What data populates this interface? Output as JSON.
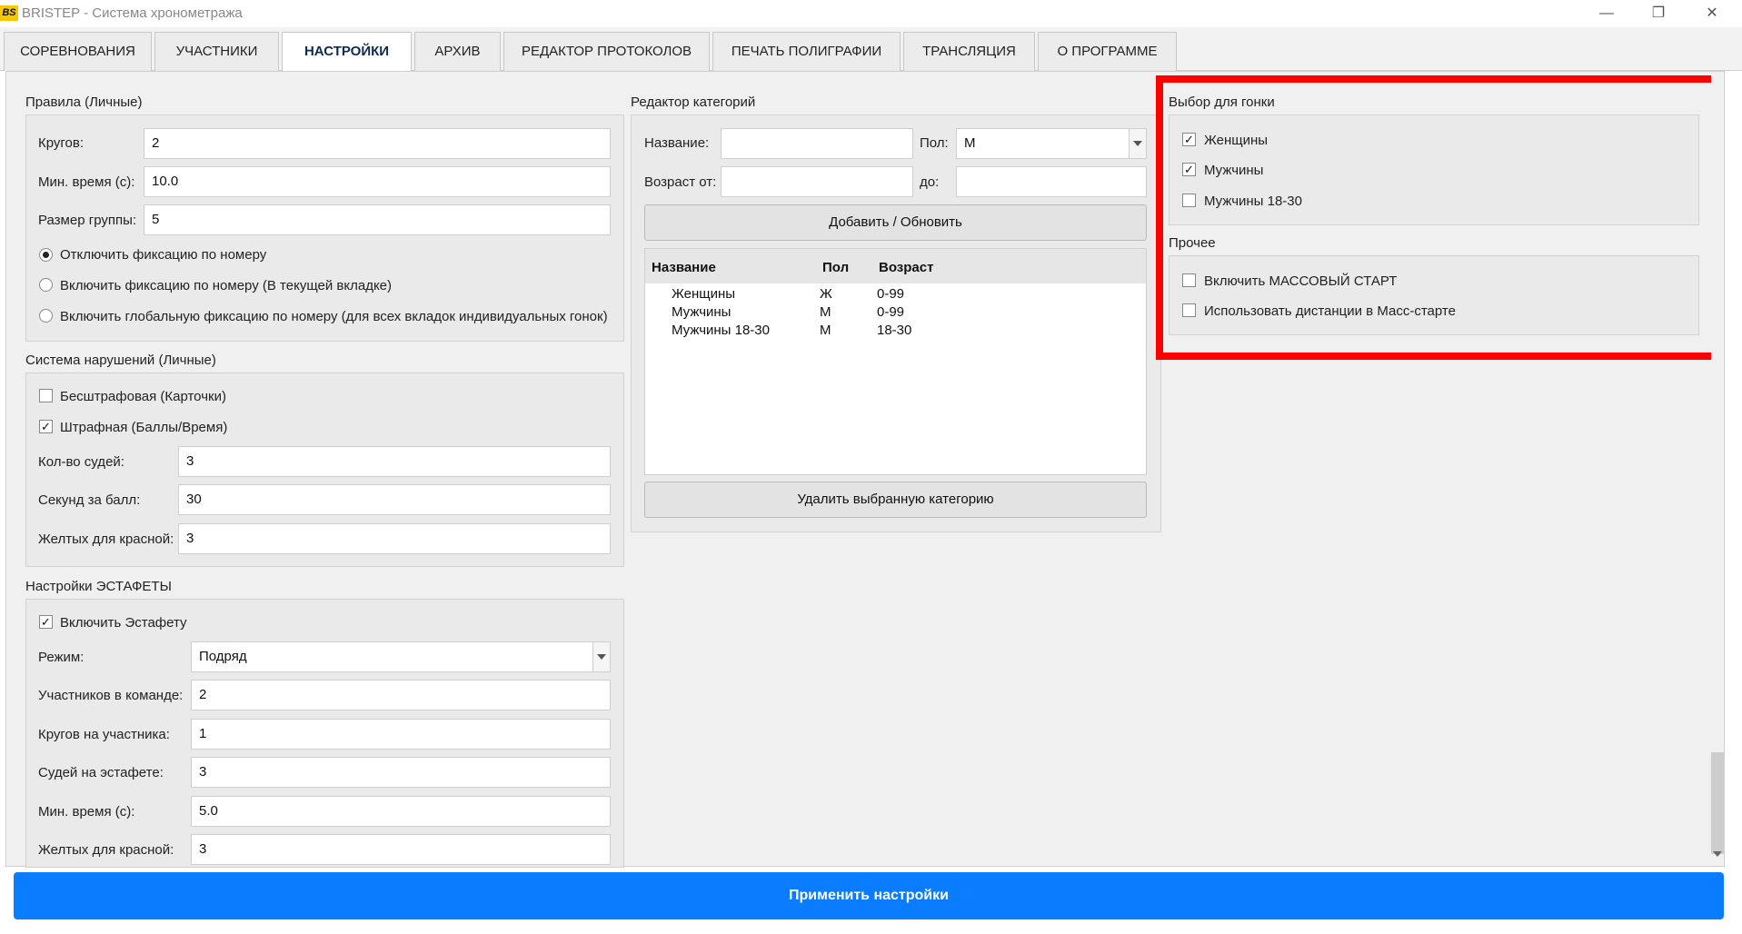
{
  "window": {
    "logo_text": "BS",
    "title": "BRISTEP - Система хронометража",
    "minimize_glyph": "—",
    "restore_glyph": "❐",
    "close_glyph": "✕"
  },
  "tabs": [
    {
      "label": "СОРЕВНОВАНИЯ"
    },
    {
      "label": "УЧАСТНИКИ"
    },
    {
      "label": "НАСТРОЙКИ",
      "active": true
    },
    {
      "label": "АРХИВ"
    },
    {
      "label": "РЕДАКТОР ПРОТОКОЛОВ"
    },
    {
      "label": "ПЕЧАТЬ ПОЛИГРАФИИ"
    },
    {
      "label": "ТРАНСЛЯЦИЯ"
    },
    {
      "label": "О ПРОГРАММЕ"
    }
  ],
  "rules": {
    "title": "Правила (Личные)",
    "laps_label": "Кругов:",
    "laps_value": "2",
    "min_time_label": "Мин. время (с):",
    "min_time_value": "10.0",
    "group_size_label": "Размер группы:",
    "group_size_value": "5",
    "radios": [
      {
        "label": "Отключить фиксацию по номеру",
        "checked": true
      },
      {
        "label": "Включить фиксацию по номеру (В текущей вкладке)",
        "checked": false
      },
      {
        "label": "Включить глобальную фиксацию по номеру (для всех вкладок индивидуальных гонок)",
        "checked": false
      }
    ]
  },
  "violations": {
    "title": "Система нарушений (Личные)",
    "checks": [
      {
        "label": "Бесштрафовая (Карточки)",
        "checked": false
      },
      {
        "label": "Штрафная (Баллы/Время)",
        "checked": true
      }
    ],
    "judges_label": "Кол-во судей:",
    "judges_value": "3",
    "seconds_label": "Секунд за балл:",
    "seconds_value": "30",
    "yellow_label": "Желтых для красной:",
    "yellow_value": "3"
  },
  "relay": {
    "title": "Настройки ЭСТАФЕТЫ",
    "enable_label": "Включить Эстафету",
    "enable_checked": true,
    "mode_label": "Режим:",
    "mode_value": "Подряд",
    "team_label": "Участников в команде:",
    "team_value": "2",
    "laps_label": "Кругов на участника:",
    "laps_value": "1",
    "judges_label": "Судей на эстафете:",
    "judges_value": "3",
    "min_time_label": "Мин. время (с):",
    "min_time_value": "5.0",
    "yellow_label": "Желтых для красной:",
    "yellow_value": "3"
  },
  "categories": {
    "title": "Редактор категорий",
    "name_label": "Название:",
    "name_value": "",
    "sex_label": "Пол:",
    "sex_value": "М",
    "age_from_label": "Возраст от:",
    "age_from_value": "",
    "age_to_label": "до:",
    "age_to_value": "",
    "add_button": "Добавить / Обновить",
    "delete_button": "Удалить выбранную категорию",
    "columns": [
      "Название",
      "Пол",
      "Возраст"
    ],
    "rows": [
      {
        "name": "Женщины",
        "sex": "Ж",
        "age": "0-99"
      },
      {
        "name": "Мужчины",
        "sex": "М",
        "age": "0-99"
      },
      {
        "name": "Мужчины 18-30",
        "sex": "М",
        "age": "18-30"
      }
    ]
  },
  "race_select": {
    "title": "Выбор для гонки",
    "checks": [
      {
        "label": "Женщины",
        "checked": true
      },
      {
        "label": "Мужчины",
        "checked": true
      },
      {
        "label": "Мужчины 18-30",
        "checked": false
      }
    ]
  },
  "other": {
    "title": "Прочее",
    "checks": [
      {
        "label": "Включить МАССОВЫЙ СТАРТ",
        "checked": false
      },
      {
        "label": "Использовать дистанции в Масс-старте",
        "checked": false
      }
    ]
  },
  "apply_button": "Применить настройки",
  "highlight_color": "#ff0000",
  "accent_color": "#0a7cff"
}
